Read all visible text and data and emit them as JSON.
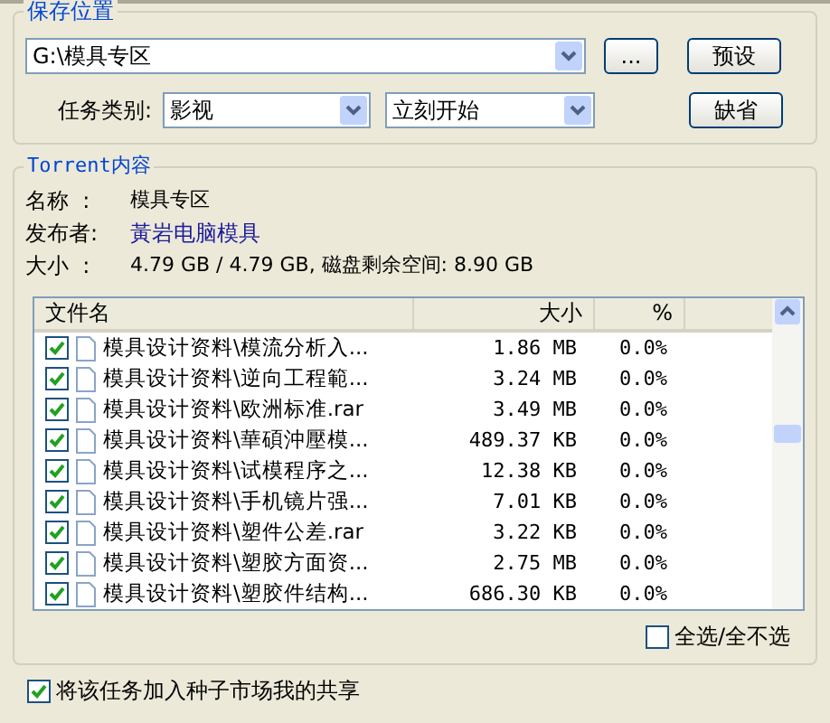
{
  "save_location": {
    "title": "保存位置",
    "path": "G:\\模具专区",
    "browse_button": "...",
    "preset_button": "预设",
    "category_label": "任务类别:",
    "category": "影视",
    "start_mode": "立刻开始",
    "default_button": "缺省"
  },
  "torrent": {
    "title": "Torrent内容",
    "info": [
      {
        "label": "名称",
        "sep": ":",
        "value": "模具专区",
        "kind": "plain"
      },
      {
        "label": "发布者:",
        "value": "黃岩电脑模具",
        "kind": "link"
      },
      {
        "label": "大小",
        "sep": ":",
        "value": "4.79 GB / 4.79 GB, 磁盘剩余空间: 8.90 GB",
        "kind": "plain"
      }
    ],
    "columns": [
      "文件名",
      "大小",
      "%"
    ],
    "rows": [
      {
        "name": "模具设计资料\\模流分析入...",
        "size": "1.86 MB",
        "percent": "0.0%",
        "checked": true
      },
      {
        "name": "模具设计资料\\逆向工程範...",
        "size": "3.24 MB",
        "percent": "0.0%",
        "checked": true
      },
      {
        "name": "模具设计资料\\欧洲标准.rar",
        "size": "3.49 MB",
        "percent": "0.0%",
        "checked": true
      },
      {
        "name": "模具设计资料\\華碩沖壓模...",
        "size": "489.37 KB",
        "percent": "0.0%",
        "checked": true
      },
      {
        "name": "模具设计资料\\试模程序之...",
        "size": "12.38 KB",
        "percent": "0.0%",
        "checked": true
      },
      {
        "name": "模具设计资料\\手机镜片强...",
        "size": "7.01 KB",
        "percent": "0.0%",
        "checked": true
      },
      {
        "name": "模具设计资料\\塑件公差.rar",
        "size": "3.22 KB",
        "percent": "0.0%",
        "checked": true
      },
      {
        "name": "模具设计资料\\塑胶方面资...",
        "size": "2.75 MB",
        "percent": "0.0%",
        "checked": true
      },
      {
        "name": "模具设计资料\\塑胶件结构...",
        "size": "686.30 KB",
        "percent": "0.0%",
        "checked": true
      }
    ],
    "select_all": {
      "label": "全选/全不选",
      "checked": false
    }
  },
  "share": {
    "label": "将该任务加入种子市场我的共享",
    "checked": true
  }
}
